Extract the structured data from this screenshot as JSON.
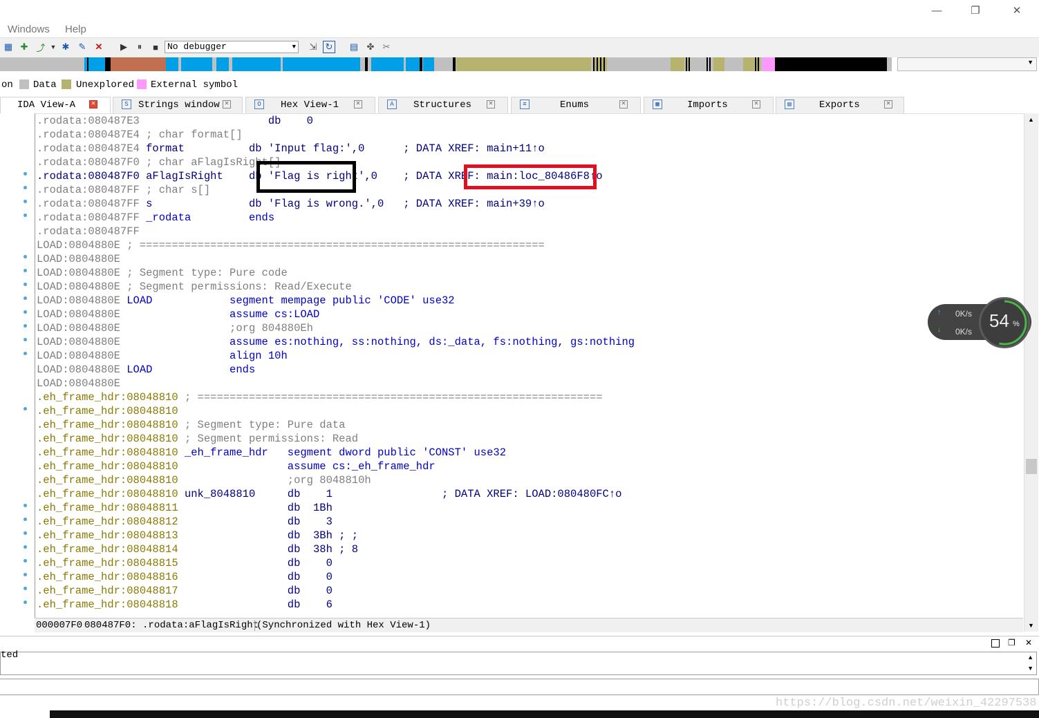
{
  "window": {
    "controls": [
      "—",
      "❐",
      "✕"
    ]
  },
  "menu": [
    "Windows",
    "Help"
  ],
  "toolbar": {
    "debugger": "No debugger"
  },
  "legend": {
    "items": [
      {
        "label": "on",
        "color": ""
      },
      {
        "label": "Data",
        "color": "#c0c0c0"
      },
      {
        "label": "Unexplored",
        "color": "#b5b36d"
      },
      {
        "label": "External symbol",
        "color": "#ff99ff"
      }
    ]
  },
  "tabs": [
    {
      "label": "IDA View-A",
      "active": true
    },
    {
      "label": "Strings window",
      "active": false
    },
    {
      "label": "Hex View-1",
      "active": false
    },
    {
      "label": "Structures",
      "active": false
    },
    {
      "label": "Enums",
      "active": false
    },
    {
      "label": "Imports",
      "active": false
    },
    {
      "label": "Exports",
      "active": false
    }
  ],
  "lines": [
    {
      "addr": ".rodata:080487E3",
      "rest": "                    db    0",
      "kind": "gray"
    },
    {
      "addr": ".rodata:080487E4",
      "rest": " ; char format[]",
      "kind": "gray"
    },
    {
      "addr": ".rodata:080487E4",
      "rest": " format          db 'Input flag:',0      ; DATA XREF: main+11↑o",
      "kind": "gray"
    },
    {
      "addr": ".rodata:080487F0",
      "rest": " ; char aFlagIsRight[]",
      "kind": "gray"
    },
    {
      "addr": ".rodata:080487F0",
      "rest": " aFlagIsRight    db 'Flag is right',0    ; DATA XREF: main:loc_80486F8↑o",
      "kind": "blue"
    },
    {
      "addr": ".rodata:080487FF",
      "rest": " ; char s[]",
      "kind": "gray"
    },
    {
      "addr": ".rodata:080487FF",
      "rest": " s               db 'Flag is wrong.',0   ; DATA XREF: main+39↑o",
      "kind": "gray"
    },
    {
      "addr": ".rodata:080487FF",
      "rest": " _rodata         ends",
      "kind": "gray"
    },
    {
      "addr": ".rodata:080487FF",
      "rest": "",
      "kind": "gray"
    },
    {
      "addr": "LOAD:0804880E",
      "rest": " ; ===============================================================",
      "kind": "gray"
    },
    {
      "addr": "LOAD:0804880E",
      "rest": "",
      "kind": "gray"
    },
    {
      "addr": "LOAD:0804880E",
      "rest": " ; Segment type: Pure code",
      "kind": "gray"
    },
    {
      "addr": "LOAD:0804880E",
      "rest": " ; Segment permissions: Read/Execute",
      "kind": "gray"
    },
    {
      "addr": "LOAD:0804880E",
      "rest": " LOAD            segment mempage public 'CODE' use32",
      "kind": "gray"
    },
    {
      "addr": "LOAD:0804880E",
      "rest": "                 assume cs:LOAD",
      "kind": "gray"
    },
    {
      "addr": "LOAD:0804880E",
      "rest": "                 ;org 804880Eh",
      "kind": "gray"
    },
    {
      "addr": "LOAD:0804880E",
      "rest": "                 assume es:nothing, ss:nothing, ds:_data, fs:nothing, gs:nothing",
      "kind": "gray"
    },
    {
      "addr": "LOAD:0804880E",
      "rest": "                 align 10h",
      "kind": "gray"
    },
    {
      "addr": "LOAD:0804880E",
      "rest": " LOAD            ends",
      "kind": "gray"
    },
    {
      "addr": "LOAD:0804880E",
      "rest": "",
      "kind": "gray"
    },
    {
      "addr": ".eh_frame_hdr:08048810",
      "rest": " ; ===============================================================",
      "kind": "olive"
    },
    {
      "addr": ".eh_frame_hdr:08048810",
      "rest": "",
      "kind": "olive"
    },
    {
      "addr": ".eh_frame_hdr:08048810",
      "rest": " ; Segment type: Pure data",
      "kind": "olive"
    },
    {
      "addr": ".eh_frame_hdr:08048810",
      "rest": " ; Segment permissions: Read",
      "kind": "olive"
    },
    {
      "addr": ".eh_frame_hdr:08048810",
      "rest": " _eh_frame_hdr   segment dword public 'CONST' use32",
      "kind": "olive"
    },
    {
      "addr": ".eh_frame_hdr:08048810",
      "rest": "                 assume cs:_eh_frame_hdr",
      "kind": "olive"
    },
    {
      "addr": ".eh_frame_hdr:08048810",
      "rest": "                 ;org 8048810h",
      "kind": "olive"
    },
    {
      "addr": ".eh_frame_hdr:08048810",
      "rest": " unk_8048810     db    1                 ; DATA XREF: LOAD:080480FC↑o",
      "kind": "olive"
    },
    {
      "addr": ".eh_frame_hdr:08048811",
      "rest": "                 db  1Bh",
      "kind": "olive"
    },
    {
      "addr": ".eh_frame_hdr:08048812",
      "rest": "                 db    3",
      "kind": "olive"
    },
    {
      "addr": ".eh_frame_hdr:08048813",
      "rest": "                 db  3Bh ; ;",
      "kind": "olive"
    },
    {
      "addr": ".eh_frame_hdr:08048814",
      "rest": "                 db  38h ; 8",
      "kind": "olive"
    },
    {
      "addr": ".eh_frame_hdr:08048815",
      "rest": "                 db    0",
      "kind": "olive"
    },
    {
      "addr": ".eh_frame_hdr:08048816",
      "rest": "                 db    0",
      "kind": "olive"
    },
    {
      "addr": ".eh_frame_hdr:08048817",
      "rest": "                 db    0",
      "kind": "olive"
    },
    {
      "addr": ".eh_frame_hdr:08048818",
      "rest": "                 db    6",
      "kind": "olive"
    }
  ],
  "status": {
    "offset": "000007F0",
    "location": "080487F0: .rodata:aFlagIsRight",
    "sync": "(Synchronized with Hex View-1)"
  },
  "output": {
    "text": "ted"
  },
  "net_widget": {
    "up": "0K/s",
    "down": "0K/s",
    "percent": "54",
    "percent_sign": "%"
  },
  "watermark": "https://blog.csdn.net/weixin_42297538"
}
